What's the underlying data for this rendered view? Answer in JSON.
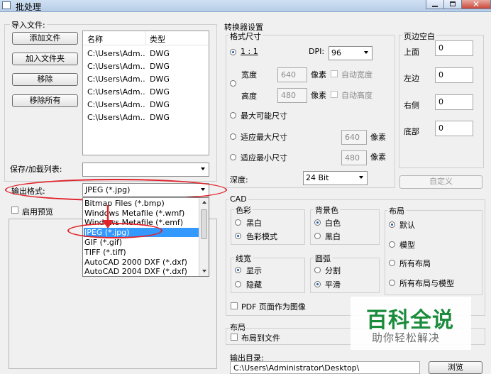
{
  "window": {
    "title": "批处理"
  },
  "import": {
    "group_label": "导入文件:",
    "buttons": {
      "add_file": "添加文件",
      "add_folder": "加入文件夹",
      "remove": "移除",
      "remove_all": "移除所有"
    },
    "table": {
      "headers": [
        "名称",
        "类型"
      ],
      "rows": [
        [
          "C:\\Users\\Adm...",
          "DWG"
        ],
        [
          "C:\\Users\\Adm...",
          "DWG"
        ],
        [
          "C:\\Users\\Adm...",
          "DWG"
        ],
        [
          "C:\\Users\\Adm...",
          "DWG"
        ],
        [
          "C:\\Users\\Adm...",
          "DWG"
        ],
        [
          "C:\\Users\\Adm...",
          "DWG"
        ]
      ]
    }
  },
  "save_load": {
    "label": "保存/加载列表:",
    "value": ""
  },
  "output_format": {
    "label": "输出格式:",
    "value": "JPEG (*.jpg)",
    "options": [
      "Bitmap Files (*.bmp)",
      "Windows Metafile (*.wmf)",
      "Windows Metafile (*.emf)",
      "JPEG (*.jpg)",
      "GIF (*.gif)",
      "TIFF (*.tiff)",
      "AutoCAD 2000 DXF (*.dxf)",
      "AutoCAD 2004 DXF (*.dxf)"
    ],
    "selected_index": 3
  },
  "preview": {
    "label": "启用预览"
  },
  "converter": {
    "group_label": "转换器设置",
    "format_size": {
      "group_label": "格式尺寸",
      "ratio_label": "1 : 1",
      "dpi_label": "DPI:",
      "dpi_value": "96",
      "width_label": "宽度",
      "width_value": "640",
      "height_label": "高度",
      "height_value": "480",
      "pixel_unit": "像素",
      "auto_width": "自动宽度",
      "auto_height": "自动高度",
      "max_possible": "最大可能尺寸",
      "fit_max": "适应最大尺寸",
      "fit_max_value": "640",
      "fit_min": "适应最小尺寸",
      "fit_min_value": "480",
      "depth_label": "深度:",
      "depth_value": "24 Bit"
    },
    "margins": {
      "group_label": "页边空白",
      "top_label": "上面",
      "top_value": "0",
      "left_label": "左边",
      "left_value": "0",
      "right_label": "右侧",
      "right_value": "0",
      "bottom_label": "底部",
      "bottom_value": "0",
      "custom_button": "自定义"
    }
  },
  "cad": {
    "group_label": "CAD",
    "color": {
      "label": "色彩",
      "opt1": "黑白",
      "opt2": "色彩模式"
    },
    "background": {
      "label": "背景色",
      "opt1": "白色",
      "opt2": "黑白"
    },
    "layout": {
      "label": "布局",
      "opt1": "默认",
      "opt2": "模型",
      "opt3": "所有布局",
      "opt4": "所有布局与模型"
    },
    "linewidth": {
      "label": "线宽",
      "opt1": "显示",
      "opt2": "隐藏"
    },
    "arc": {
      "label": "圆弧",
      "opt1": "分割",
      "opt2": "平滑"
    },
    "pdf_pages": "PDF 页面作为图像"
  },
  "layout_section": {
    "group_label": "布局",
    "layout_to_file": "布局到文件"
  },
  "output_dir": {
    "label": "输出目录:",
    "value": "C:\\Users\\Administrator\\Desktop\\",
    "browse": "浏览"
  },
  "watermark": {
    "main": "百科全说",
    "sub": "助你轻松解决"
  },
  "colors": {
    "annotation_red": "#e0222a",
    "selection_blue": "#3399ff",
    "watermark_green": "#1a8c3c"
  }
}
